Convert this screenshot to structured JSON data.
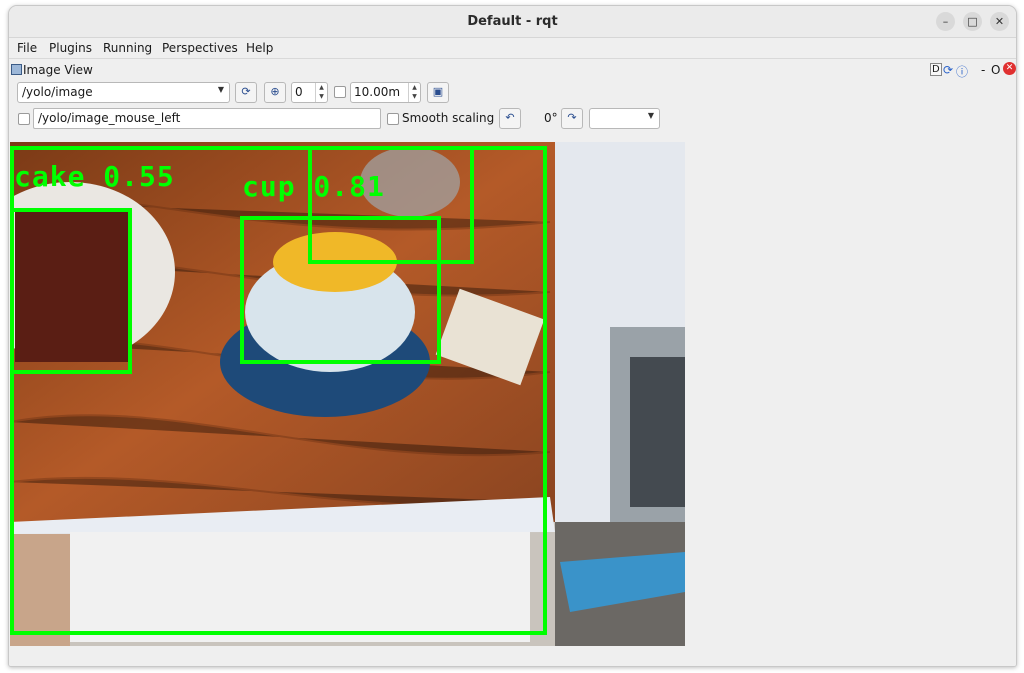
{
  "window": {
    "title": "Default - rqt"
  },
  "menu": [
    "File",
    "Plugins",
    "Running",
    "Perspectives",
    "Help"
  ],
  "dock": {
    "title": "Image View",
    "controls": [
      "D",
      "O"
    ]
  },
  "toolbar": {
    "topic": "/yolo/image",
    "numeric_value": "0",
    "max_range": "10.00m",
    "mouse_topic": "/yolo/image_mouse_left",
    "smooth_scaling": "Smooth scaling",
    "rotation": "0°"
  },
  "detections": [
    {
      "label": "cake 0.55"
    },
    {
      "label": "cup 0.81"
    }
  ],
  "colors": {
    "bbox": "#00ff00"
  }
}
